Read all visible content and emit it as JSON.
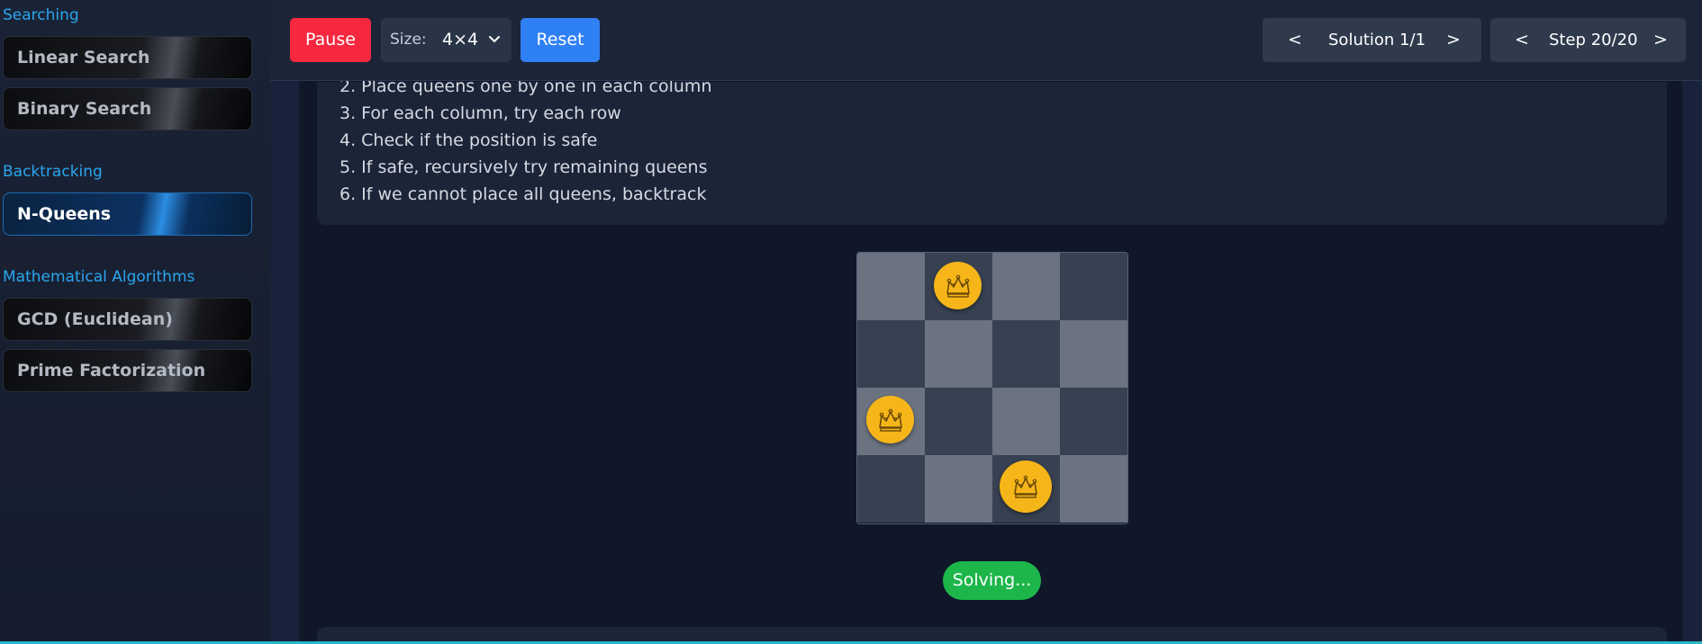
{
  "sidebar": {
    "sections": [
      {
        "heading": "Searching",
        "items": [
          "Linear Search",
          "Binary Search"
        ]
      },
      {
        "heading": "Backtracking",
        "items": [
          "N-Queens"
        ]
      },
      {
        "heading": "Mathematical Algorithms",
        "items": [
          "GCD (Euclidean)",
          "Prime Factorization"
        ]
      }
    ],
    "active_item": "N-Queens"
  },
  "toolbar": {
    "pause_label": "Pause",
    "size_label": "Size:",
    "size_value": "4×4",
    "reset_label": "Reset",
    "solution_prev": "<",
    "solution_text": "Solution 1/1",
    "solution_next": ">",
    "step_prev": "<",
    "step_text": "Step 20/20",
    "step_next": ">"
  },
  "steps": [
    "2. Place queens one by one in each column",
    "3. For each column, try each row",
    "4. Check if the position is safe",
    "5. If safe, recursively try remaining queens",
    "6. If we cannot place all queens, backtrack"
  ],
  "board": {
    "size": 4,
    "queens": [
      {
        "row": 0,
        "col": 1
      },
      {
        "row": 2,
        "col": 0
      },
      {
        "row": 3,
        "col": 2
      }
    ],
    "queen_icon": "crown-icon"
  },
  "status": "Solving...",
  "colors": {
    "pause": "#f5283f",
    "reset": "#2f80f5",
    "accent_heading": "#2aa6ee",
    "queen": "#f6b619",
    "status_green": "#1db64a",
    "cell_light": "#6b7280",
    "cell_dark": "#374151"
  }
}
